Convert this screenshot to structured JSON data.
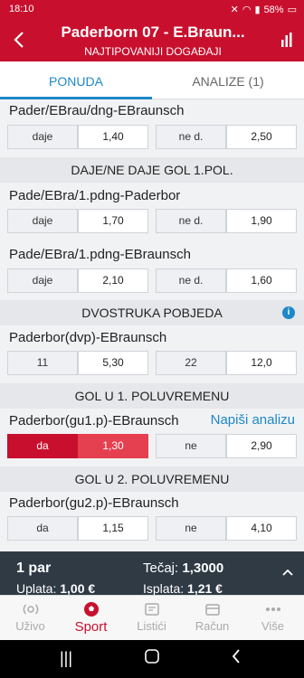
{
  "status": {
    "time": "18:10",
    "battery": "58%"
  },
  "header": {
    "title": "Paderborn 07 - E.Braun...",
    "subtitle": "NAJTIPOVANIJI DOGAĐAJI"
  },
  "tabs": [
    {
      "label": "PONUDA",
      "active": true
    },
    {
      "label": "ANALIZE (1)",
      "active": false
    }
  ],
  "markets": {
    "m1": {
      "title": "Pader/EBrau/dng-EBraunsch",
      "o1_label": "daje",
      "o1_value": "1,40",
      "o2_label": "ne d.",
      "o2_value": "2,50"
    },
    "sec1": "DAJE/NE DAJE GOL 1.POL.",
    "m2": {
      "title": "Pade/EBra/1.pdng-Paderbor",
      "o1_label": "daje",
      "o1_value": "1,70",
      "o2_label": "ne d.",
      "o2_value": "1,90"
    },
    "m3": {
      "title": "Pade/EBra/1.pdng-EBraunsch",
      "o1_label": "daje",
      "o1_value": "2,10",
      "o2_label": "ne d.",
      "o2_value": "1,60"
    },
    "sec2": "DVOSTRUKA POBJEDA",
    "m4": {
      "title": "Paderbor(dvp)-EBraunsch",
      "o1_label": "11",
      "o1_value": "5,30",
      "o2_label": "22",
      "o2_value": "12,0"
    },
    "sec3": "GOL U 1. POLUVREMENU",
    "m5": {
      "title": "Paderbor(gu1.p)-EBraunsch",
      "link": "Napiši analizu",
      "o1_label": "da",
      "o1_value": "1,30",
      "o2_label": "ne",
      "o2_value": "2,90"
    },
    "sec4": "GOL U 2. POLUVREMENU",
    "m6": {
      "title": "Paderbor(gu2.p)-EBraunsch",
      "o1_label": "da",
      "o1_value": "1,15",
      "o2_label": "ne",
      "o2_value": "4,10"
    }
  },
  "betslip": {
    "pairs": "1 par",
    "stake_label": "Uplata:",
    "stake_value": "1,00 €",
    "odds_label": "Tečaj:",
    "odds_value": "1,3000",
    "payout_label": "Isplata:",
    "payout_value": "1,21 €"
  },
  "nav": [
    {
      "label": "Uživo",
      "icon": "live-icon"
    },
    {
      "label": "Sport",
      "icon": "football-icon",
      "active": true
    },
    {
      "label": "Listići",
      "icon": "ticket-icon"
    },
    {
      "label": "Račun",
      "icon": "account-icon"
    },
    {
      "label": "Više",
      "icon": "more-icon"
    }
  ],
  "colors": {
    "brand": "#c8102e",
    "accent": "#1e88c8",
    "selected": "#e5404f"
  }
}
